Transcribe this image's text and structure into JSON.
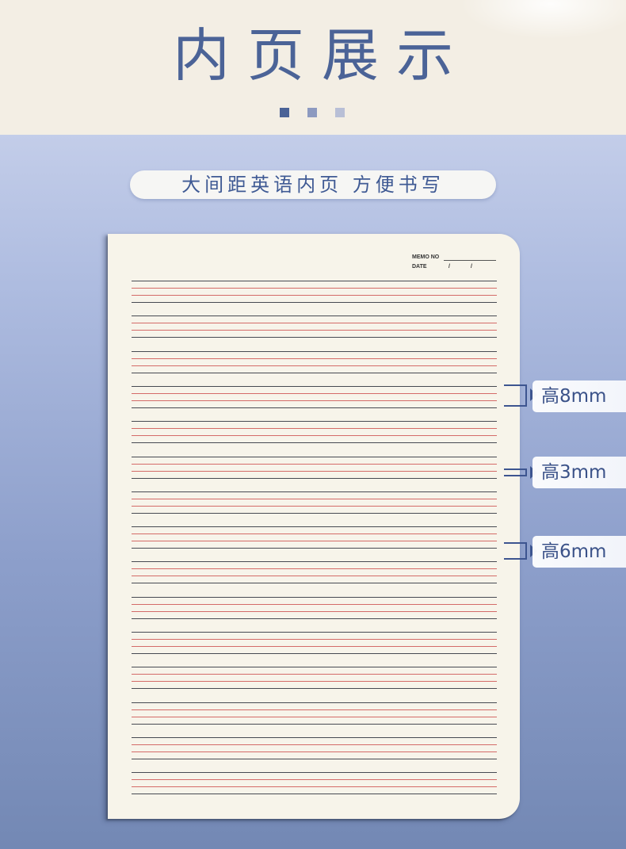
{
  "header": {
    "title": "内页展示",
    "dot_colors": [
      "#4b6397",
      "#8d9ac0",
      "#b8bfd6"
    ]
  },
  "subtitle": {
    "text": "大间距英语内页   方便书写"
  },
  "page": {
    "memo_label": "MEMO NO",
    "date_label": "DATE",
    "date_slash_1": "/",
    "date_slash_2": "/",
    "line_colors": {
      "guide": "#474a52",
      "midline": "#d46b68"
    }
  },
  "callouts": [
    {
      "label": "高8mm",
      "icon": "bracket-arrow-icon"
    },
    {
      "label": "高3mm",
      "icon": "bracket-arrow-icon"
    },
    {
      "label": "高6mm",
      "icon": "bracket-arrow-icon"
    }
  ],
  "colors": {
    "accent": "#3d5590",
    "header_bg": "#f3eee4",
    "paper": "#f7f4ea"
  }
}
